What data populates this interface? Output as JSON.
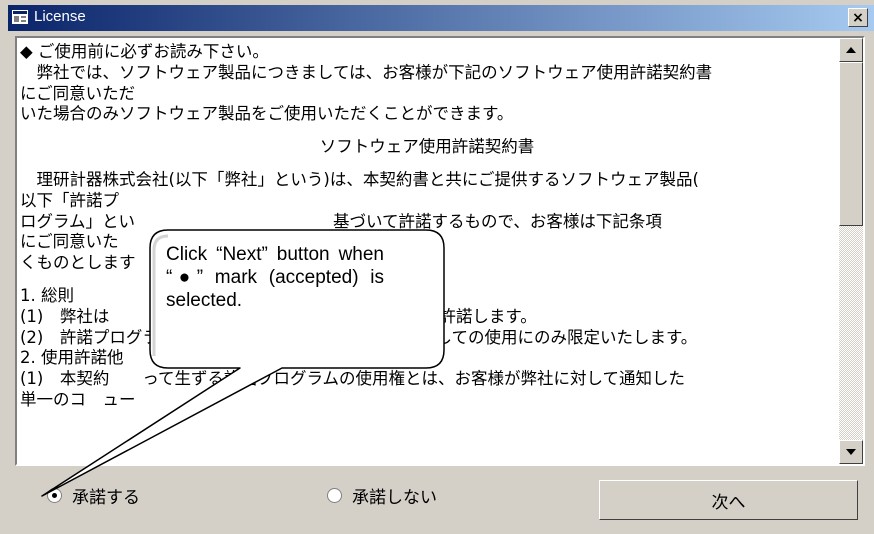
{
  "window": {
    "title": "License",
    "close_label": "×"
  },
  "license": {
    "lines": [
      "◆ ご使用前に必ずお読み下さい。",
      "　弊社では、ソフトウェア製品につきましては、お客様が下記のソフトウェア使用許諾契約書",
      "にご同意いただ",
      "いた場合のみソフトウェア製品をご使用いただくことができます。",
      "ソフトウェア使用許諾契約書",
      "　理研計器株式会社(以下「弊社」という)は、本契約書と共にご提供するソフトウェア製品(",
      "以下「許諾プ",
      "ログラム」とい　　　　　　　　　　　　基づいて許諾するもので、お客様は下記条項",
      "にご同意いた",
      "くものとします",
      "1. 総則",
      "(1)　弊社は　　　　　　　　　　　　　　権をお客様に許諾します。",
      "(2)　許諾プログラ　　　　弊社製品「SW - FI21」に関しての使用にのみ限定いたします。",
      "2. 使用許諾他",
      "(1)　本契約　　って生ずる許諾プログラムの使用権とは、お客様が弊社に対して通知した",
      "単一のコ　ュー"
    ]
  },
  "options": {
    "accept_label": "承諾する",
    "decline_label": "承諾しない",
    "selected": "accept"
  },
  "buttons": {
    "next_label": "次へ"
  },
  "callout": {
    "text": "Click “Next” button when “●” mark (accepted) is selected."
  },
  "colors": {
    "title_start": "#0a246a",
    "title_end": "#a6caf0",
    "face": "#d4d0c8",
    "callout_fill": "#ffffff",
    "callout_border": "#000000"
  }
}
